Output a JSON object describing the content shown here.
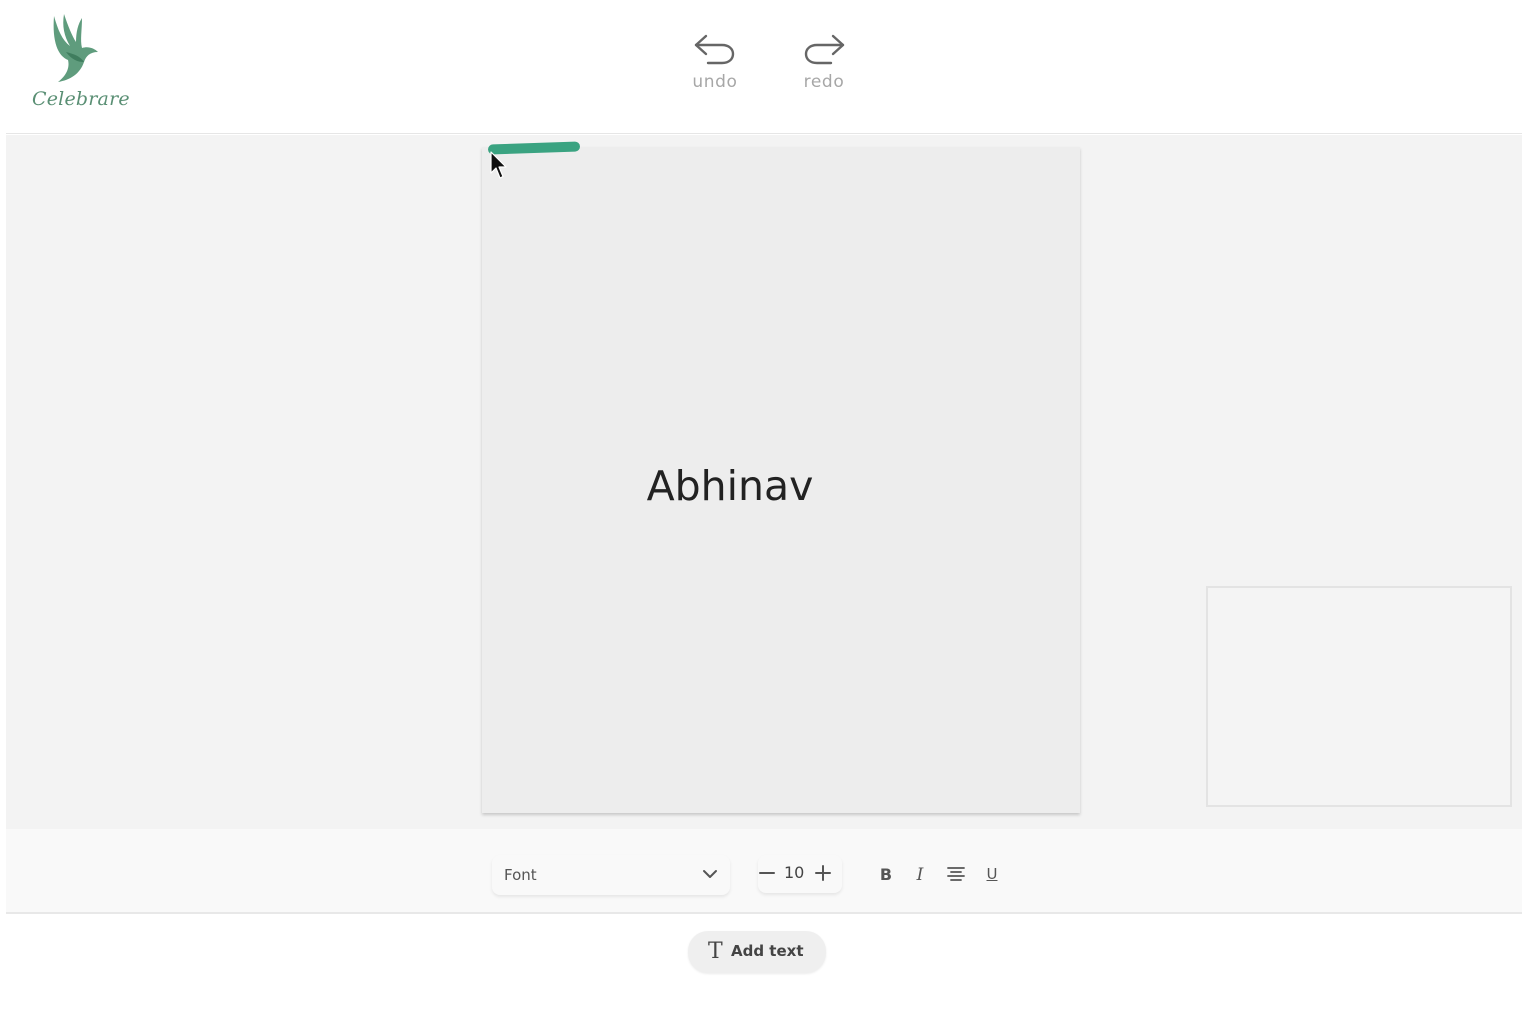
{
  "brand": {
    "name": "Celebrare",
    "accent": "#3aa381",
    "logo_icon": "dove-icon"
  },
  "history": {
    "undo_label": "undo",
    "redo_label": "redo"
  },
  "card": {
    "text": "Abhinav"
  },
  "toolbar": {
    "font_label": "Font",
    "font_size": "10",
    "bold_label": "B",
    "italic_label": "I",
    "underline_label": "U"
  },
  "add_text": {
    "label": "Add text"
  }
}
